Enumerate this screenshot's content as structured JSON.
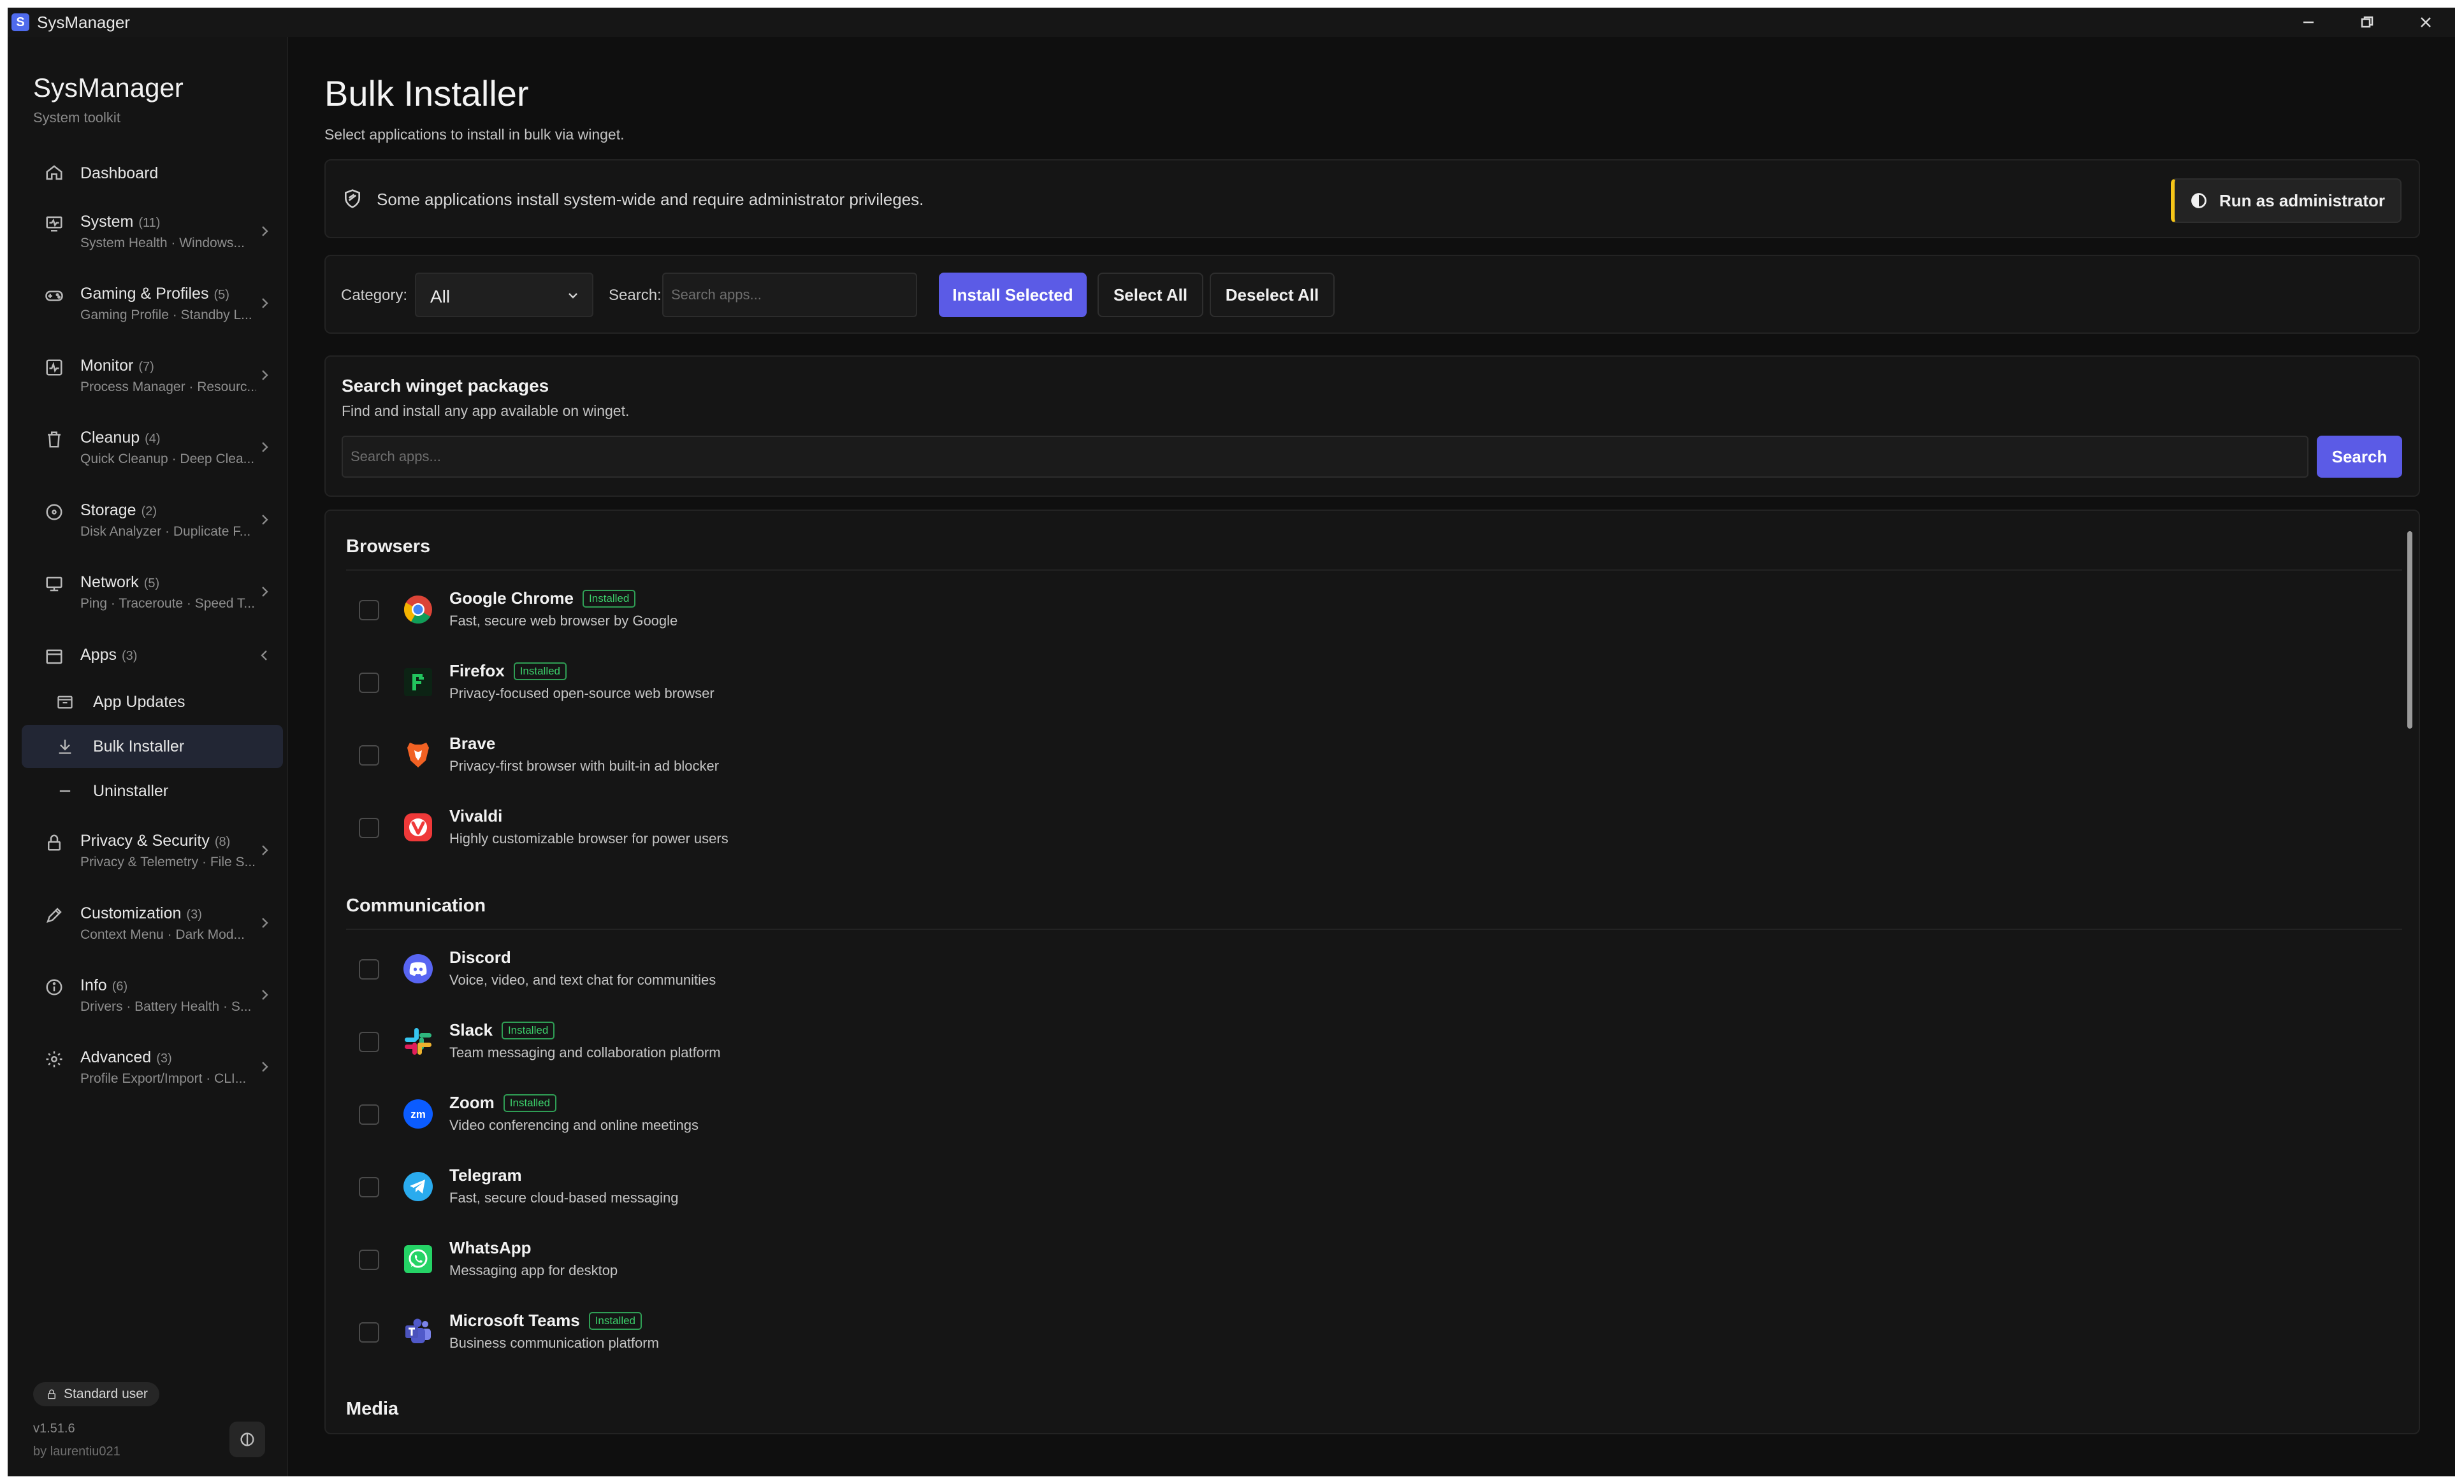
{
  "window": {
    "title": "SysManager",
    "app_badge": "S"
  },
  "sidebar": {
    "brand": "SysManager",
    "tagline": "System toolkit",
    "dashboard": "Dashboard",
    "groups": [
      {
        "label": "System",
        "count": "(11)",
        "sub": "System Health · Windows...",
        "icon": "monitor-heart-icon"
      },
      {
        "label": "Gaming & Profiles",
        "count": "(5)",
        "sub": "Gaming Profile · Standby L...",
        "icon": "gamepad-icon"
      },
      {
        "label": "Monitor",
        "count": "(7)",
        "sub": "Process Manager · Resourc...",
        "icon": "activity-icon"
      },
      {
        "label": "Cleanup",
        "count": "(4)",
        "sub": "Quick Cleanup · Deep Clea...",
        "icon": "trash-icon"
      },
      {
        "label": "Storage",
        "count": "(2)",
        "sub": "Disk Analyzer · Duplicate F...",
        "icon": "disk-icon"
      },
      {
        "label": "Network",
        "count": "(5)",
        "sub": "Ping · Traceroute · Speed T...",
        "icon": "network-icon"
      }
    ],
    "apps": {
      "label": "Apps",
      "count": "(3)",
      "children": [
        "App Updates",
        "Bulk Installer",
        "Uninstaller"
      ],
      "active_child": "Bulk Installer"
    },
    "groups_after": [
      {
        "label": "Privacy & Security",
        "count": "(8)",
        "sub": "Privacy & Telemetry · File S...",
        "icon": "lock-icon"
      },
      {
        "label": "Customization",
        "count": "(3)",
        "sub": "Context Menu · Dark Mod...",
        "icon": "brush-icon"
      },
      {
        "label": "Info",
        "count": "(6)",
        "sub": "Drivers · Battery Health · S...",
        "icon": "info-icon"
      },
      {
        "label": "Advanced",
        "count": "(3)",
        "sub": "Profile Export/Import · CLI...",
        "icon": "gear-icon"
      }
    ],
    "role": "Standard user",
    "version": "v1.51.6",
    "author": "by laurentiu021"
  },
  "page": {
    "title": "Bulk Installer",
    "subtitle": "Select applications to install in bulk via winget."
  },
  "alert": {
    "text": "Some applications install system-wide and require administrator privileges.",
    "button": "Run as administrator"
  },
  "filters": {
    "category_label": "Category:",
    "category_value": "All",
    "search_label": "Search:",
    "search_placeholder": "Search apps...",
    "install_selected": "Install Selected",
    "select_all": "Select All",
    "deselect_all": "Deselect All"
  },
  "winget": {
    "title": "Search winget packages",
    "subtitle": "Find and install any app available on winget.",
    "placeholder": "Search apps...",
    "button": "Search"
  },
  "installed_badge": "Installed",
  "sections": [
    {
      "title": "Browsers",
      "apps": [
        {
          "name": "Google Chrome",
          "desc": "Fast, secure web browser by Google",
          "installed": true,
          "icon": "chrome-icon"
        },
        {
          "name": "Firefox",
          "desc": "Privacy-focused open-source web browser",
          "installed": true,
          "icon": "firefox-icon"
        },
        {
          "name": "Brave",
          "desc": "Privacy-first browser with built-in ad blocker",
          "installed": false,
          "icon": "brave-icon"
        },
        {
          "name": "Vivaldi",
          "desc": "Highly customizable browser for power users",
          "installed": false,
          "icon": "vivaldi-icon"
        }
      ]
    },
    {
      "title": "Communication",
      "apps": [
        {
          "name": "Discord",
          "desc": "Voice, video, and text chat for communities",
          "installed": false,
          "icon": "discord-icon"
        },
        {
          "name": "Slack",
          "desc": "Team messaging and collaboration platform",
          "installed": true,
          "icon": "slack-icon"
        },
        {
          "name": "Zoom",
          "desc": "Video conferencing and online meetings",
          "installed": true,
          "icon": "zoom-icon"
        },
        {
          "name": "Telegram",
          "desc": "Fast, secure cloud-based messaging",
          "installed": false,
          "icon": "telegram-icon"
        },
        {
          "name": "WhatsApp",
          "desc": "Messaging app for desktop",
          "installed": false,
          "icon": "whatsapp-icon"
        },
        {
          "name": "Microsoft Teams",
          "desc": "Business communication platform",
          "installed": true,
          "icon": "teams-icon"
        }
      ]
    },
    {
      "title": "Media",
      "apps": []
    }
  ],
  "colors": {
    "accent": "#5b5be6",
    "installed_green": "#3ccf6b",
    "admin_bar": "#f5c518",
    "background": "#101010"
  }
}
